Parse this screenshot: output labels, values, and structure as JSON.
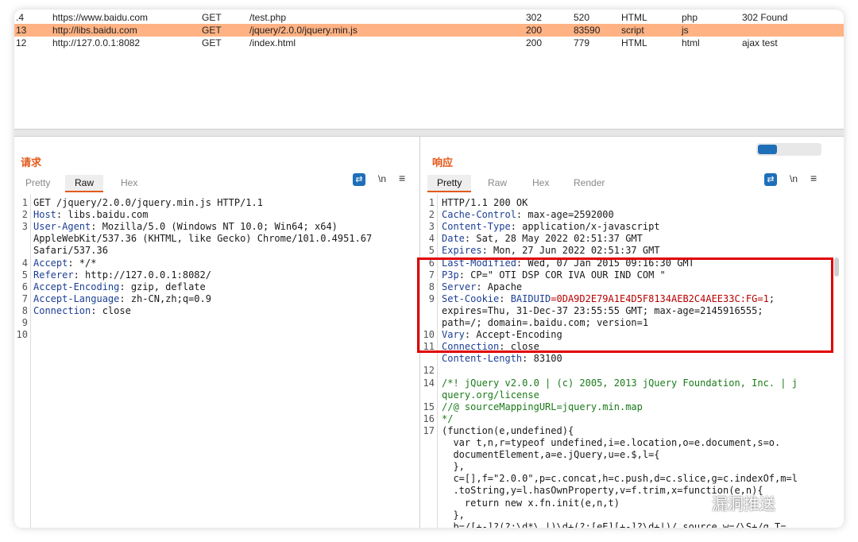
{
  "history": {
    "rows": [
      {
        "num": ".4",
        "host": "https://www.baidu.com",
        "method": "GET",
        "url": "/test.php",
        "status": "302",
        "length": "520",
        "mime": "HTML",
        "ext": "php",
        "title": "302 Found"
      },
      {
        "num": "13",
        "host": "http://libs.baidu.com",
        "method": "GET",
        "url": "/jquery/2.0.0/jquery.min.js",
        "status": "200",
        "length": "83590",
        "mime": "script",
        "ext": "js",
        "title": ""
      },
      {
        "num": "12",
        "host": "http://127.0.0.1:8082",
        "method": "GET",
        "url": "/index.html",
        "status": "200",
        "length": "779",
        "mime": "HTML",
        "ext": "html",
        "title": "ajax test"
      }
    ]
  },
  "request": {
    "title": "请求",
    "tabs": [
      "Pretty",
      "Raw",
      "Hex"
    ],
    "active_tab": "Raw",
    "wrap_icon": "⇄",
    "newline_label": "\\n",
    "menu_icon": "≡",
    "lines": [
      {
        "n": "1",
        "text": "GET /jquery/2.0.0/jquery.min.js HTTP/1.1"
      },
      {
        "n": "2",
        "key": "Host",
        "val": ": libs.baidu.com"
      },
      {
        "n": "3",
        "key": "User-Agent",
        "val": ": Mozilla/5.0 (Windows NT 10.0; Win64; x64)"
      },
      {
        "n": "",
        "text": "AppleWebKit/537.36 (KHTML, like Gecko) Chrome/101.0.4951.67"
      },
      {
        "n": "",
        "text": "Safari/537.36"
      },
      {
        "n": "4",
        "key": "Accept",
        "val": ": */*"
      },
      {
        "n": "5",
        "key": "Referer",
        "val": ": http://127.0.0.1:8082/"
      },
      {
        "n": "6",
        "key": "Accept-Encoding",
        "val": ": gzip, deflate"
      },
      {
        "n": "7",
        "key": "Accept-Language",
        "val": ": zh-CN,zh;q=0.9"
      },
      {
        "n": "8",
        "key": "Connection",
        "val": ": close"
      },
      {
        "n": "9",
        "text": ""
      },
      {
        "n": "10",
        "text": ""
      }
    ]
  },
  "response": {
    "title": "响应",
    "tabs": [
      "Pretty",
      "Raw",
      "Hex",
      "Render"
    ],
    "active_tab": "Pretty",
    "wrap_icon": "⇄",
    "newline_label": "\\n",
    "menu_icon": "≡",
    "lines": [
      {
        "n": "1",
        "text": "HTTP/1.1 200 OK"
      },
      {
        "n": "2",
        "key": "Cache-Control",
        "val": ": max-age=2592000"
      },
      {
        "n": "3",
        "key": "Content-Type",
        "val": ": application/x-javascript"
      },
      {
        "n": "4",
        "key": "Date",
        "val": ": Sat, 28 May 2022 02:51:37 GMT"
      },
      {
        "n": "5",
        "key": "Expires",
        "val": ": Mon, 27 Jun 2022 02:51:37 GMT"
      },
      {
        "n": "6",
        "key": "Last-Modified",
        "val": ": Wed, 07 Jan 2015 09:16:30 GMT"
      },
      {
        "n": "7",
        "key": "P3p",
        "val": ": CP=\" OTI DSP COR IVA OUR IND COM \""
      },
      {
        "n": "8",
        "key": "Server",
        "val": ": Apache"
      },
      {
        "n": "9",
        "key": "Set-Cookie",
        "val": ": ",
        "cookie_name": "BAIDUID",
        "cookie_val": "=0DA9D2E79A1E4D5F8134AEB2C4AEE33C:FG=1",
        "tail": ";"
      },
      {
        "n": "",
        "text": "expires=Thu, 31-Dec-37 23:55:55 GMT; max-age=2145916555;"
      },
      {
        "n": "",
        "text": "path=/; domain=.baidu.com; version=1"
      },
      {
        "n": "10",
        "key": "Vary",
        "val": ": Accept-Encoding"
      },
      {
        "n": "11",
        "key": "Connection",
        "val": ": close"
      },
      {
        "n": "",
        "key": "Content-Length",
        "val": ": 83100"
      },
      {
        "n": "12",
        "text": ""
      },
      {
        "n": "14",
        "green": "/*! jQuery v2.0.0 | (c) 2005, 2013 jQuery Foundation, Inc. | j"
      },
      {
        "n": "",
        "green": "query.org/license"
      },
      {
        "n": "15",
        "green": "//@ sourceMappingURL=jquery.min.map"
      },
      {
        "n": "16",
        "green": "*/"
      },
      {
        "n": "17",
        "text": "(function(e,undefined){"
      },
      {
        "n": "",
        "text": "  var t,n,r=typeof undefined,i=e.location,o=e.document,s=o."
      },
      {
        "n": "",
        "text": "  documentElement,a=e.jQuery,u=e.$,l={"
      },
      {
        "n": "",
        "text": "  },"
      },
      {
        "n": "",
        "text": "  c=[],f=\"2.0.0\",p=c.concat,h=c.push,d=c.slice,g=c.indexOf,m=l"
      },
      {
        "n": "",
        "text": "  .toString,y=l.hasOwnProperty,v=f.trim,x=function(e,n){"
      },
      {
        "n": "",
        "text": "    return new x.fn.init(e,n,t)"
      },
      {
        "n": "",
        "text": "  },"
      },
      {
        "n": "",
        "text": "  b=/[+-]?(?:\\d*\\.|)\\d+(?:[eE][+-]?\\d+|)/.source,w=/\\S+/g,T="
      }
    ]
  },
  "watermark": "漏洞推送",
  "colors": {
    "accent": "#e35a1c",
    "selected_row": "#ffb283",
    "highlight_box": "#e00000"
  }
}
